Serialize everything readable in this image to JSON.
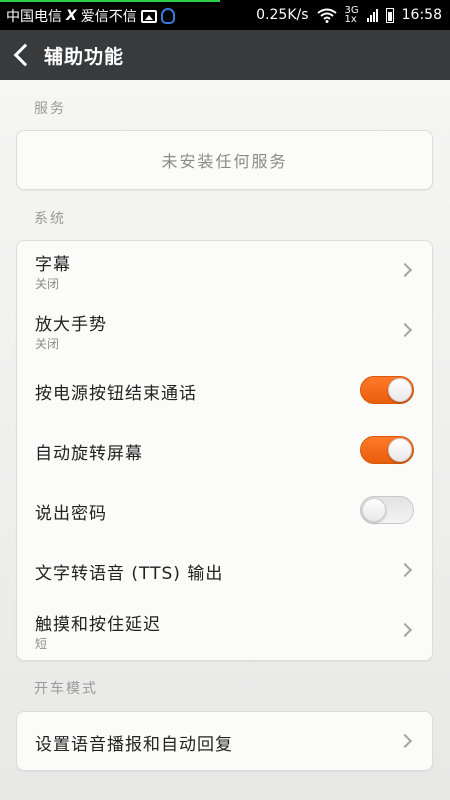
{
  "status_bar": {
    "carrier_1": "中国电信",
    "carrier_sep": "X",
    "carrier_2": "爱信不信",
    "speed": "0.25K/s",
    "net_type_top": "3G",
    "net_type_bottom": "1x",
    "time": "16:58"
  },
  "header": {
    "title": "辅助功能"
  },
  "services": {
    "section_label": "服务",
    "empty_text": "未安装任何服务"
  },
  "system": {
    "section_label": "系统",
    "items": [
      {
        "title": "字幕",
        "subtitle": "关闭"
      },
      {
        "title": "放大手势",
        "subtitle": "关闭"
      },
      {
        "title": "按电源按钮结束通话",
        "toggle": "on"
      },
      {
        "title": "自动旋转屏幕",
        "toggle": "on"
      },
      {
        "title": "说出密码",
        "toggle": "off"
      },
      {
        "title": "文字转语音 (TTS) 输出"
      },
      {
        "title": "触摸和按住延迟",
        "subtitle": "短"
      }
    ]
  },
  "driving": {
    "section_label": "开车模式",
    "items": [
      {
        "title": "设置语音播报和自动回复"
      }
    ]
  },
  "colors": {
    "accent": "#f06a1a",
    "header_bg": "#393a3c",
    "status_bg": "#000000"
  }
}
